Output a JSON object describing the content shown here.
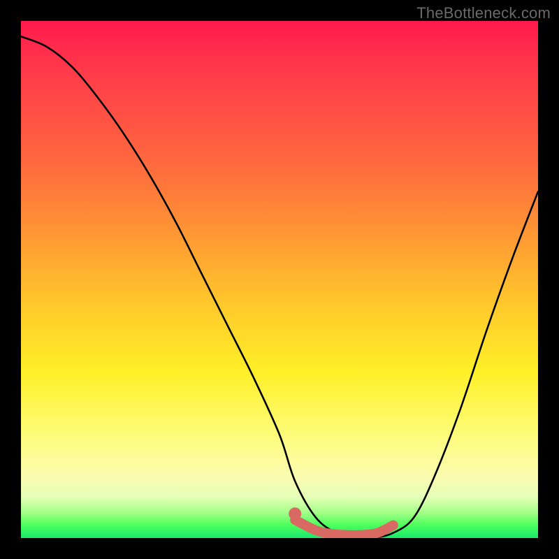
{
  "watermark": {
    "text": "TheBottleneck.com"
  },
  "chart_data": {
    "type": "line",
    "title": "",
    "xlabel": "",
    "ylabel": "",
    "xlim": [
      0,
      100
    ],
    "ylim": [
      0,
      100
    ],
    "series": [
      {
        "name": "bottleneck-curve",
        "x": [
          0,
          5,
          10,
          15,
          20,
          25,
          30,
          35,
          40,
          45,
          50,
          53,
          57,
          61,
          65,
          68,
          72,
          76,
          80,
          85,
          90,
          95,
          100
        ],
        "values": [
          97,
          95,
          91,
          85,
          78,
          70,
          61,
          51,
          41,
          31,
          20,
          11,
          4,
          1,
          0,
          0,
          1,
          4,
          12,
          25,
          40,
          54,
          67
        ]
      },
      {
        "name": "highlight-segment",
        "x": [
          53,
          57,
          60,
          63,
          66,
          69,
          72
        ],
        "values": [
          3.5,
          1.5,
          0.8,
          0.6,
          0.6,
          1.0,
          2.5
        ]
      }
    ],
    "gradient_stops": [
      {
        "pos": 0,
        "color": "#ff1a4d"
      },
      {
        "pos": 50,
        "color": "#ffc92b"
      },
      {
        "pos": 90,
        "color": "#fbfcb0"
      },
      {
        "pos": 100,
        "color": "#18e86e"
      }
    ]
  }
}
